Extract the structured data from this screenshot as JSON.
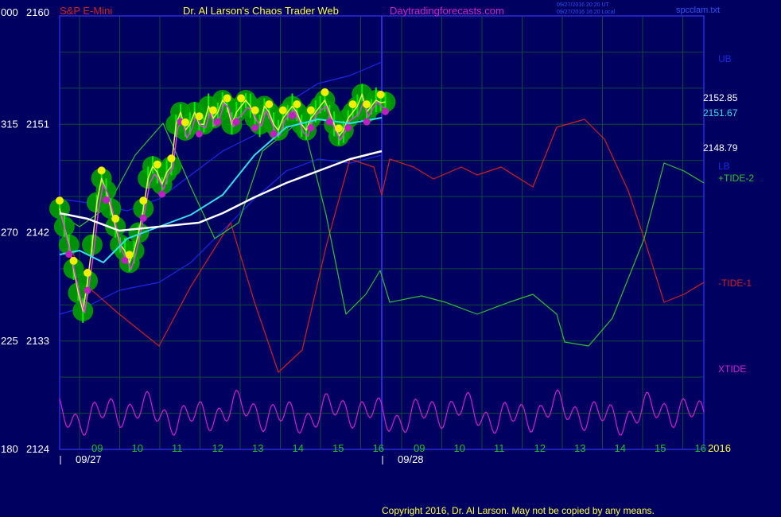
{
  "header": {
    "instrument": "S&P E-Mini",
    "site_title": "Dr. Al Larson's Chaos Trader Web",
    "site_url": "Daytradingforecasts.com",
    "timestamp_ut": "09/27/2016 20:20 UT",
    "timestamp_local": "09/27/2016 16:20 Local",
    "chart_file": "spcclam.txt"
  },
  "footer": {
    "copyright": "Copyright 2016, Dr. Al Larson. May not be copied by any means."
  },
  "colors": {
    "background": "#000060",
    "grid": "#0b4a36",
    "frame": "#2a2ad8",
    "price_candles": "#00ee00",
    "tide_minus": "#d02020",
    "tide_plus": "#30c030",
    "xtide": "#d020d0",
    "white_ma": "#ffffff",
    "cyan_ma": "#30e0f0",
    "band": "#1a28e8",
    "glow": "#00a000",
    "highs": "#f0f000",
    "lows": "#c020c0"
  },
  "chart_data": {
    "type": "line",
    "title": "S&P E-Mini",
    "y_axis": {
      "range": [
        2124,
        2160
      ],
      "ticks": [
        {
          "left": "180",
          "right": "2124",
          "value": 2124
        },
        {
          "left": "225",
          "right": "2133",
          "value": 2133
        },
        {
          "left": "270",
          "right": "2142",
          "value": 2142
        },
        {
          "left": "315",
          "right": "2151",
          "value": 2151
        },
        {
          "left": "000",
          "right": "2160",
          "value": 2160
        }
      ]
    },
    "x_axis": {
      "hour_labels": [
        "09",
        "10",
        "11",
        "12",
        "13",
        "14",
        "15",
        "16",
        "09",
        "10",
        "11",
        "12",
        "13",
        "14",
        "15",
        "16"
      ],
      "date_labels": [
        "09/27",
        "09/28"
      ],
      "year_label": "2016"
    },
    "price_levels": [
      {
        "label": "2152.85",
        "value": 2152.85,
        "color": "#ffffff"
      },
      {
        "label": "2151.67",
        "value": 2151.67,
        "color": "#30e0f0"
      },
      {
        "label": "2148.79",
        "value": 2148.79,
        "color": "#ffffff"
      }
    ],
    "right_labels": [
      {
        "label": "UB",
        "color": "#1a28e8"
      },
      {
        "label": "LB",
        "color": "#1a28e8"
      },
      {
        "label": "+TIDE-2",
        "color": "#30c030"
      },
      {
        "label": "-TIDE-1",
        "color": "#d02020"
      },
      {
        "label": "XTIDE",
        "color": "#d020d0"
      }
    ],
    "series": [
      {
        "name": "Price (E-Mini close)",
        "x": [
          0,
          0.1,
          0.2,
          0.3,
          0.4,
          0.5,
          0.6,
          0.7,
          0.8,
          0.9,
          1.0,
          1.1,
          1.2,
          1.3,
          1.4,
          1.5,
          1.6,
          1.7,
          1.8,
          1.9,
          2.0,
          2.1,
          2.2,
          2.3,
          2.4,
          2.5,
          2.6,
          2.7,
          2.8,
          2.9,
          3.0,
          3.1,
          3.2,
          3.3,
          3.4,
          3.5,
          3.6,
          3.7,
          3.8,
          3.9,
          4.0,
          4.1,
          4.2,
          4.3,
          4.4,
          4.5,
          4.6,
          4.7,
          4.8,
          4.9,
          5.0,
          5.1,
          5.2,
          5.3,
          5.4,
          5.5,
          5.6,
          5.7,
          5.8,
          5.9,
          6.0,
          6.1,
          6.2,
          6.3,
          6.4,
          6.5,
          6.6,
          6.7,
          6.8,
          6.9,
          7.0
        ],
        "y": [
          2144.0,
          2142.5,
          2141.0,
          2139.0,
          2137.0,
          2135.5,
          2138.0,
          2141.0,
          2144.5,
          2146.5,
          2145.5,
          2144.0,
          2142.5,
          2141.0,
          2140.5,
          2139.5,
          2140.5,
          2142.0,
          2144.0,
          2146.5,
          2147.5,
          2147.0,
          2146.0,
          2147.0,
          2147.5,
          2151.0,
          2152.0,
          2150.5,
          2151.0,
          2152.0,
          2151.0,
          2151.0,
          2152.5,
          2151.5,
          2152.0,
          2153.0,
          2152.5,
          2151.0,
          2152.0,
          2152.5,
          2153.0,
          2152.5,
          2151.5,
          2151.0,
          2152.5,
          2152.0,
          2151.0,
          2150.5,
          2151.5,
          2152.0,
          2152.5,
          2152.0,
          2151.0,
          2150.5,
          2151.5,
          2152.0,
          2152.5,
          2153.0,
          2152.0,
          2151.0,
          2150.0,
          2150.5,
          2151.5,
          2152.0,
          2152.5,
          2153.5,
          2152.0,
          2152.5,
          2153.0,
          2152.8,
          2152.85
        ]
      }
    ]
  }
}
